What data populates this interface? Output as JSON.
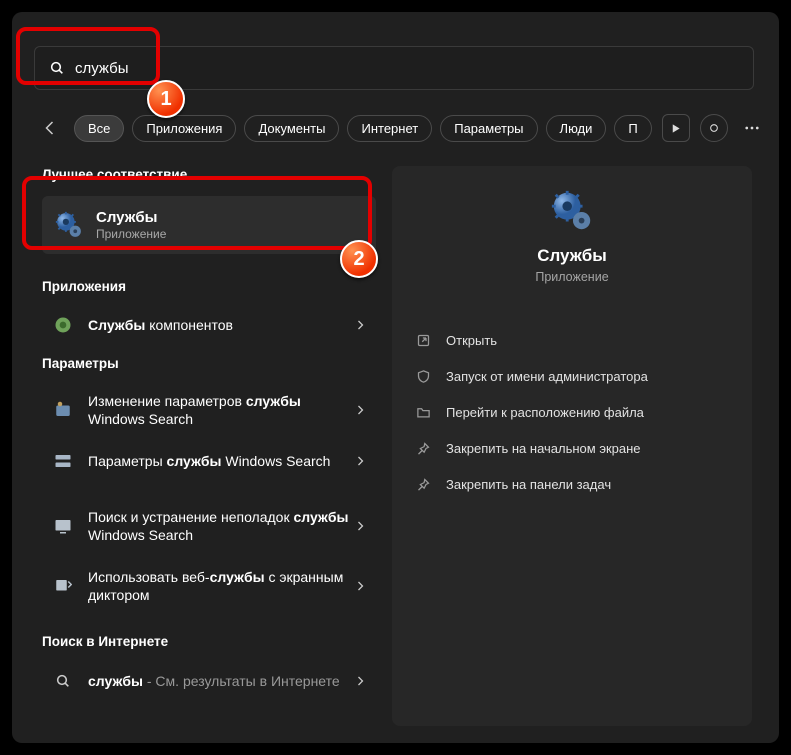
{
  "search": {
    "value": "службы"
  },
  "tabs": [
    "Все",
    "Приложения",
    "Документы",
    "Интернет",
    "Параметры",
    "Люди",
    "П"
  ],
  "sections": {
    "best": "Лучшее соответствие",
    "apps": "Приложения",
    "params": "Параметры",
    "web": "Поиск в Интернете"
  },
  "best_match": {
    "title": "Службы",
    "subtitle": "Приложение"
  },
  "app_rows": [
    {
      "prefix": "Службы",
      "suffix": " компонентов"
    }
  ],
  "param_rows": [
    {
      "html": "Изменение параметров <b>службы</b> Windows Search"
    },
    {
      "html": "Параметры <b>службы</b> Windows Search"
    },
    {
      "html": "Поиск и устранение неполадок <b>службы</b> Windows Search"
    },
    {
      "html": "Использовать веб-<b>службы</b> с экранным диктором"
    }
  ],
  "web_row": {
    "term": "службы",
    "suffix": " - См. результаты в Интернете"
  },
  "detail": {
    "title": "Службы",
    "subtitle": "Приложение",
    "actions": [
      "Открыть",
      "Запуск от имени администратора",
      "Перейти к расположению файла",
      "Закрепить на начальном экране",
      "Закрепить на панели задач"
    ]
  },
  "annotations": {
    "badge1": "1",
    "badge2": "2"
  }
}
